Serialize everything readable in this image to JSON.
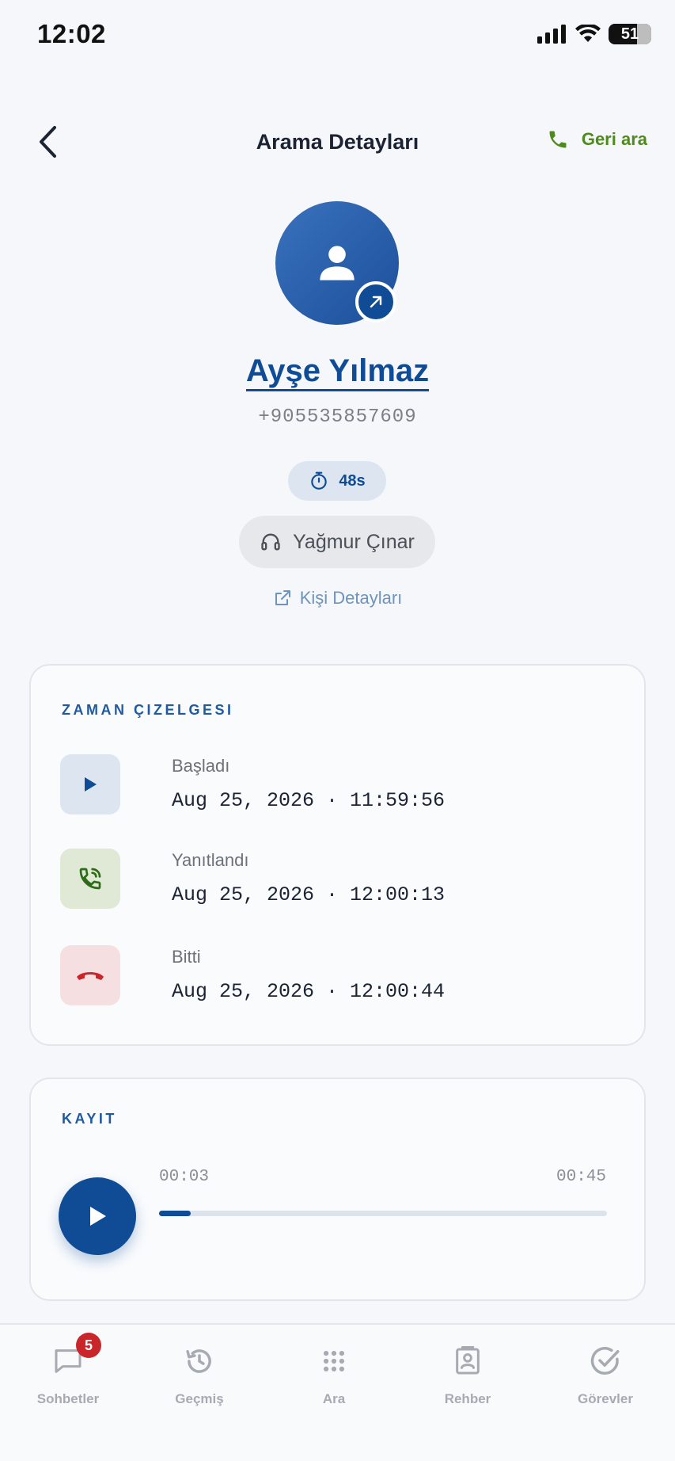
{
  "status_bar": {
    "time": "12:02",
    "battery": "51"
  },
  "header": {
    "title": "Arama Detayları",
    "callback_label": "Geri ara"
  },
  "contact": {
    "name": "Ayşe Yılmaz",
    "phone": "+905535857609",
    "duration": "48s",
    "agent": "Yağmur Çınar",
    "details_link": "Kişi Detayları"
  },
  "timeline": {
    "title": "ZAMAN ÇIZELGESI",
    "items": [
      {
        "label": "Başladı",
        "time": "Aug 25, 2026 · 11:59:56",
        "icon": "play-icon"
      },
      {
        "label": "Yanıtlandı",
        "time": "Aug 25, 2026 · 12:00:13",
        "icon": "phone-answered-icon"
      },
      {
        "label": "Bitti",
        "time": "Aug 25, 2026 · 12:00:44",
        "icon": "hang-up-icon"
      }
    ]
  },
  "recording": {
    "title": "KAYIT",
    "current": "00:03",
    "total": "00:45",
    "progress": 0.07
  },
  "bottom_nav": {
    "items": [
      {
        "label": "Sohbetler",
        "icon": "chat-icon",
        "badge": "5"
      },
      {
        "label": "Geçmiş",
        "icon": "history-icon"
      },
      {
        "label": "Ara",
        "icon": "dialpad-icon"
      },
      {
        "label": "Rehber",
        "icon": "contacts-icon"
      },
      {
        "label": "Görevler",
        "icon": "tasks-icon"
      }
    ]
  },
  "colors": {
    "primary": "#0f4c95",
    "accent_green": "#4f8a1e",
    "danger_red": "#c9262b",
    "started_bg": "#dde6f0",
    "answered_bg": "#dfe9d6",
    "ended_bg": "#f6dfe0"
  }
}
